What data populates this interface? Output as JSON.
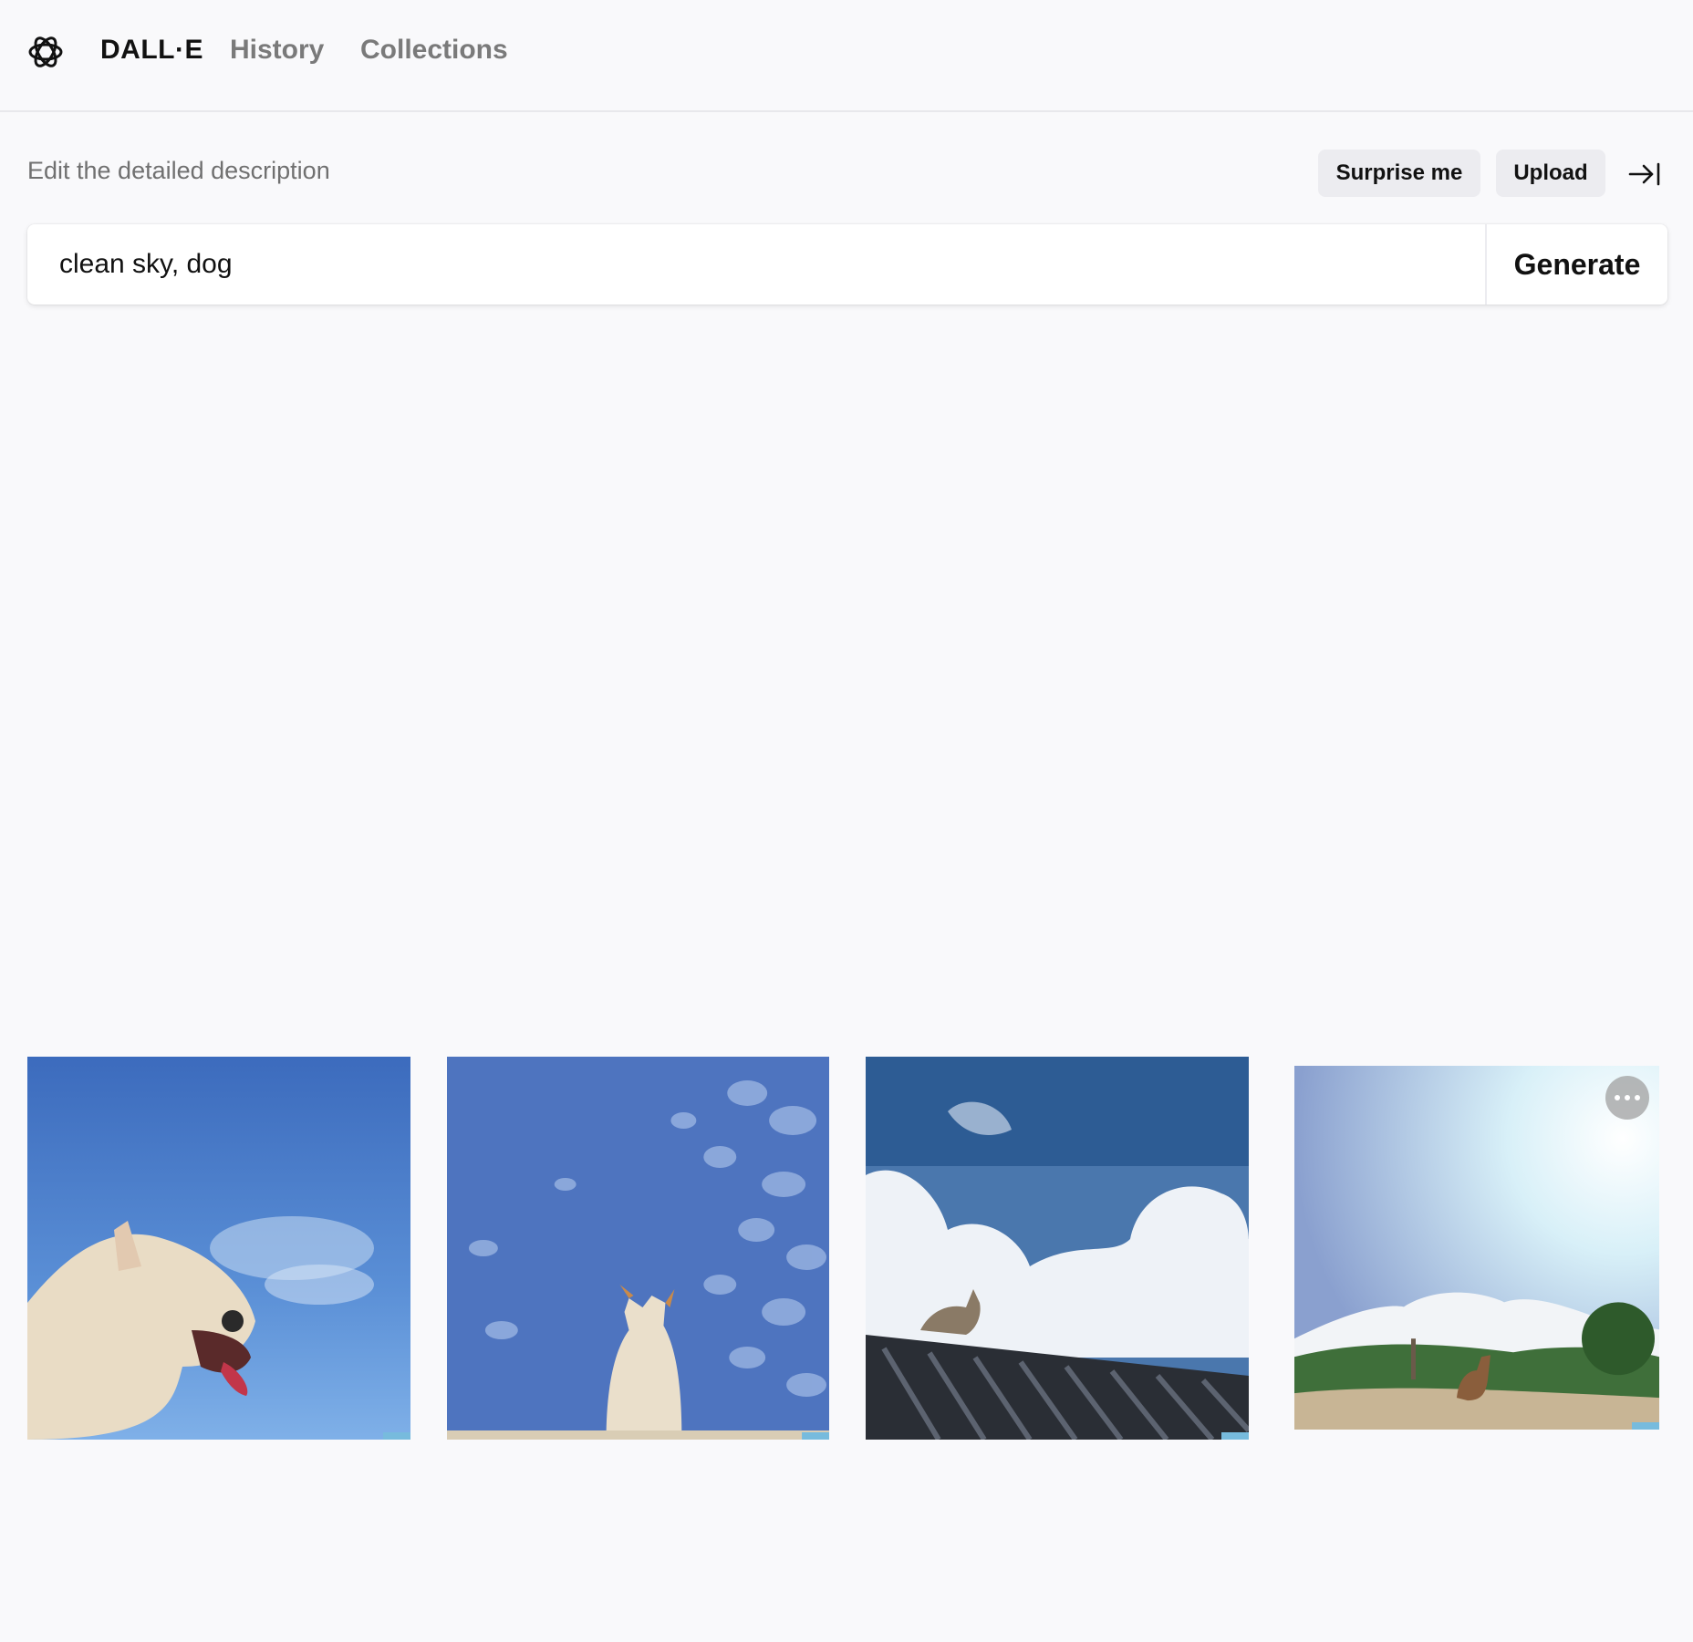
{
  "nav": {
    "brand": "DALL·E",
    "history": "History",
    "collections": "Collections",
    "logo_icon": "openai-logo-icon"
  },
  "editor": {
    "label": "Edit the detailed description",
    "surprise_label": "Surprise me",
    "upload_label": "Upload",
    "collapse_icon": "collapse-right-icon",
    "prompt_value": "clean sky, dog",
    "generate_label": "Generate"
  },
  "results": {
    "images": [
      {
        "subject": "close-up of a white dog with tongue out against blue sky"
      },
      {
        "subject": "small dog looking up at sky with scattered clouds"
      },
      {
        "subject": "dog on a dark corrugated roof under clouds"
      },
      {
        "subject": "dog sitting on a sandy hill under a bright hazy sky"
      }
    ],
    "more_icon": "more-horizontal-icon"
  }
}
